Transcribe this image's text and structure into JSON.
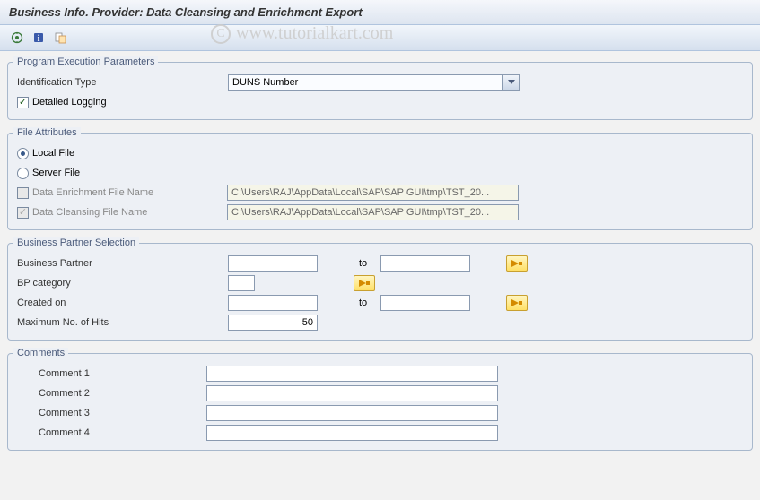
{
  "title": "Business Info. Provider: Data Cleansing and Enrichment Export",
  "watermark": "www.tutorialkart.com",
  "groups": {
    "program_exec": {
      "legend": "Program Execution Parameters",
      "identification_type_label": "Identification Type",
      "identification_type_value": "DUNS Number",
      "detailed_logging_label": "Detailed Logging",
      "detailed_logging_checked": true
    },
    "file_attributes": {
      "legend": "File Attributes",
      "local_file_label": "Local File",
      "server_file_label": "Server File",
      "selected": "local",
      "enrichment_label": "Data Enrichment File Name",
      "enrichment_value": "C:\\Users\\RAJ\\AppData\\Local\\SAP\\SAP GUI\\tmp\\TST_20...",
      "cleansing_label": "Data Cleansing File Name",
      "cleansing_value": "C:\\Users\\RAJ\\AppData\\Local\\SAP\\SAP GUI\\tmp\\TST_20..."
    },
    "bp_selection": {
      "legend": "Business Partner Selection",
      "bp_label": "Business Partner",
      "to_label": "to",
      "bp_cat_label": "BP category",
      "created_label": "Created on",
      "max_hits_label": "Maximum No. of Hits",
      "max_hits_value": "50"
    },
    "comments": {
      "legend": "Comments",
      "items": [
        {
          "label": "Comment 1"
        },
        {
          "label": "Comment 2"
        },
        {
          "label": "Comment 3"
        },
        {
          "label": "Comment 4"
        }
      ]
    }
  }
}
